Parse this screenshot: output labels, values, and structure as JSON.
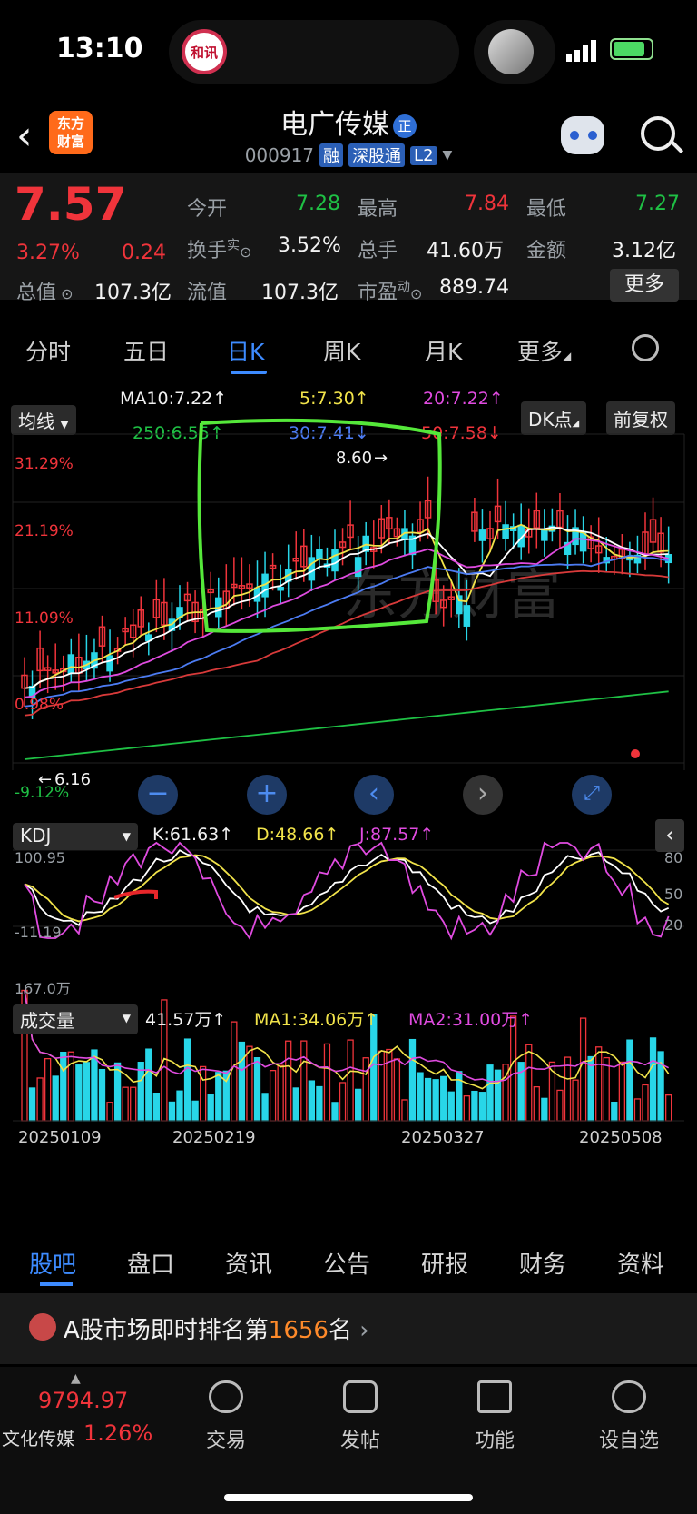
{
  "status_bar": {
    "time": "13:10",
    "island_label": "和讯"
  },
  "header": {
    "app_logo": "东方\n财富",
    "stock_name": "电广传媒",
    "name_badge": "正",
    "stock_code": "000917",
    "tags": [
      "融",
      "深股通",
      "L2"
    ]
  },
  "quote": {
    "price": "7.57",
    "change_pct": "3.27%",
    "change_amt": "0.24",
    "fields": {
      "open_label": "今开",
      "open": "7.28",
      "high_label": "最高",
      "high": "7.84",
      "low_label": "最低",
      "low": "7.27",
      "turnover_label": "换手",
      "turnover_sup": "实",
      "turnover": "3.52%",
      "volume_label": "总手",
      "volume": "41.60万",
      "amount_label": "金额",
      "amount": "3.12亿",
      "mktcap_label": "总值",
      "mktcap": "107.3亿",
      "float_label": "流值",
      "float": "107.3亿",
      "pe_label": "市盈",
      "pe_sup": "动",
      "pe": "889.74"
    },
    "more_label": "更多"
  },
  "tabs": [
    "分时",
    "五日",
    "日K",
    "周K",
    "月K",
    "更多"
  ],
  "ma_panel": {
    "selector": "均线",
    "ma10": "MA10:7.22",
    "ma5": "5:7.30",
    "ma20": "20:7.22",
    "ma250": "250:6.55",
    "ma30": "30:7.41",
    "ma50": "50:7.58",
    "dk_btn": "DK点",
    "fq_btn": "前复权"
  },
  "chart_labels": {
    "pct_top": "31.29%",
    "pct_2": "21.19%",
    "pct_3": "11.09%",
    "pct_4": "0.98%",
    "pct_bottom": "-9.12%",
    "high_marker": "8.60",
    "low_marker": "6.16",
    "watermark": "东方财富"
  },
  "kdj": {
    "selector": "KDJ",
    "k": "K:61.63",
    "d": "D:48.66",
    "j": "J:87.57",
    "top": "100.95",
    "bottom": "-11.19",
    "r80": "80",
    "r50": "50",
    "r20": "20"
  },
  "volume": {
    "selector": "成交量",
    "value": "41.57万",
    "ma1": "MA1:34.06万",
    "ma2": "MA2:31.00万",
    "top": "167.0万",
    "dates": [
      "20250109",
      "20250219",
      "20250327",
      "20250508"
    ]
  },
  "bottom_tabs": [
    "股吧",
    "盘口",
    "资讯",
    "公告",
    "研报",
    "财务",
    "资料"
  ],
  "rank": {
    "prefix": "A股市场即时排名第",
    "number": "1656",
    "suffix": "名"
  },
  "bottom_nav": {
    "index_value": "9794.97",
    "index_name": "文化传媒",
    "index_pct": "1.26%",
    "items": [
      "交易",
      "发帖",
      "功能",
      "设自选"
    ]
  },
  "colors": {
    "up": "#f0343b",
    "down": "#28d6e8",
    "ma5": "#f1e34a",
    "ma10": "#ffffff",
    "ma20": "#e04be0",
    "ma30": "#4c7cf3",
    "ma50": "#d83a3a",
    "ma250": "#1fc145",
    "accent": "#3d8bff",
    "annotation": "#55e83a"
  }
}
